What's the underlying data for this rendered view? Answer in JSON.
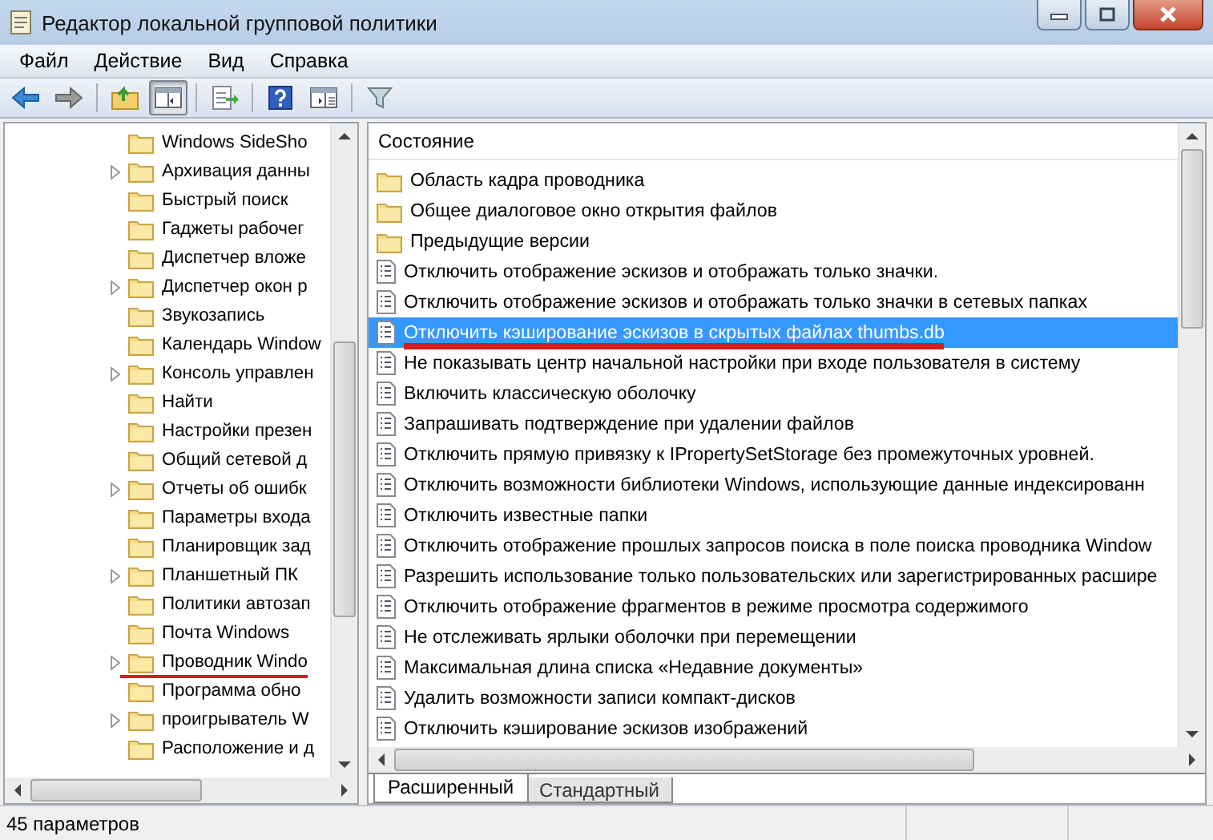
{
  "window": {
    "title": "Редактор локальной групповой политики"
  },
  "menu": [
    "Файл",
    "Действие",
    "Вид",
    "Справка"
  ],
  "toolbar": [
    {
      "kind": "back",
      "pressed": false
    },
    {
      "kind": "forward",
      "pressed": false
    },
    {
      "kind": "sep"
    },
    {
      "kind": "up",
      "pressed": false
    },
    {
      "kind": "tree",
      "pressed": true
    },
    {
      "kind": "sep"
    },
    {
      "kind": "export",
      "pressed": false
    },
    {
      "kind": "sep"
    },
    {
      "kind": "help",
      "pressed": false
    },
    {
      "kind": "pane",
      "pressed": false
    },
    {
      "kind": "sep"
    },
    {
      "kind": "filter",
      "pressed": false
    }
  ],
  "tree": [
    {
      "label": "Windows SideSho",
      "expandable": false,
      "marked": false
    },
    {
      "label": "Архивация данны",
      "expandable": true,
      "marked": false
    },
    {
      "label": "Быстрый поиск",
      "expandable": false,
      "marked": false
    },
    {
      "label": "Гаджеты рабочег",
      "expandable": false,
      "marked": false
    },
    {
      "label": "Диспетчер вложе",
      "expandable": false,
      "marked": false
    },
    {
      "label": "Диспетчер окон р",
      "expandable": true,
      "marked": false
    },
    {
      "label": "Звукозапись",
      "expandable": false,
      "marked": false
    },
    {
      "label": "Календарь Window",
      "expandable": false,
      "marked": false
    },
    {
      "label": "Консоль управлен",
      "expandable": true,
      "marked": false
    },
    {
      "label": "Найти",
      "expandable": false,
      "marked": false
    },
    {
      "label": "Настройки презен",
      "expandable": false,
      "marked": false
    },
    {
      "label": "Общий сетевой д",
      "expandable": false,
      "marked": false
    },
    {
      "label": "Отчеты об ошибк",
      "expandable": true,
      "marked": false
    },
    {
      "label": "Параметры входа",
      "expandable": false,
      "marked": false
    },
    {
      "label": "Планировщик зад",
      "expandable": false,
      "marked": false
    },
    {
      "label": "Планшетный ПК",
      "expandable": true,
      "marked": false
    },
    {
      "label": "Политики автозап",
      "expandable": false,
      "marked": false
    },
    {
      "label": "Почта Windows",
      "expandable": false,
      "marked": false
    },
    {
      "label": "Проводник Windo",
      "expandable": true,
      "marked": true
    },
    {
      "label": "Программа обно",
      "expandable": false,
      "marked": false
    },
    {
      "label": "проигрыватель W",
      "expandable": true,
      "marked": false
    },
    {
      "label": "Расположение и д",
      "expandable": false,
      "marked": false
    }
  ],
  "list": {
    "column": "Состояние",
    "rows": [
      {
        "kind": "folder",
        "label": "Область кадра проводника",
        "selected": false,
        "marked": false
      },
      {
        "kind": "folder",
        "label": "Общее диалоговое окно открытия файлов",
        "selected": false,
        "marked": false
      },
      {
        "kind": "folder",
        "label": "Предыдущие версии",
        "selected": false,
        "marked": false
      },
      {
        "kind": "setting",
        "label": "Отключить отображение эскизов и отображать только значки.",
        "selected": false,
        "marked": false
      },
      {
        "kind": "setting",
        "label": "Отключить отображение эскизов и отображать только значки в сетевых папках",
        "selected": false,
        "marked": false
      },
      {
        "kind": "setting",
        "label": "Отключить кэширование эскизов в скрытых файлах thumbs.db",
        "selected": true,
        "marked": true
      },
      {
        "kind": "setting",
        "label": "Не показывать центр начальной настройки при входе пользователя в систему",
        "selected": false,
        "marked": false
      },
      {
        "kind": "setting",
        "label": "Включить классическую оболочку",
        "selected": false,
        "marked": false
      },
      {
        "kind": "setting",
        "label": "Запрашивать подтверждение при удалении файлов",
        "selected": false,
        "marked": false
      },
      {
        "kind": "setting",
        "label": "Отключить прямую привязку к IPropertySetStorage без промежуточных уровней.",
        "selected": false,
        "marked": false
      },
      {
        "kind": "setting",
        "label": "Отключить возможности библиотеки Windows, использующие данные индексированн",
        "selected": false,
        "marked": false
      },
      {
        "kind": "setting",
        "label": "Отключить известные папки",
        "selected": false,
        "marked": false
      },
      {
        "kind": "setting",
        "label": "Отключить отображение прошлых запросов поиска в поле поиска проводника Window",
        "selected": false,
        "marked": false
      },
      {
        "kind": "setting",
        "label": "Разрешить использование только пользовательских или зарегистрированных расшире",
        "selected": false,
        "marked": false
      },
      {
        "kind": "setting",
        "label": "Отключить отображение фрагментов в режиме просмотра содержимого",
        "selected": false,
        "marked": false
      },
      {
        "kind": "setting",
        "label": "Не отслеживать ярлыки оболочки при перемещении",
        "selected": false,
        "marked": false
      },
      {
        "kind": "setting",
        "label": "Максимальная длина списка «Недавние документы»",
        "selected": false,
        "marked": false
      },
      {
        "kind": "setting",
        "label": "Удалить возможности записи компакт-дисков",
        "selected": false,
        "marked": false
      },
      {
        "kind": "setting",
        "label": "Отключить кэширование эскизов изображений",
        "selected": false,
        "marked": false
      }
    ]
  },
  "tabs": [
    {
      "label": "Расширенный",
      "selected": true
    },
    {
      "label": "Стандартный",
      "selected": false
    }
  ],
  "status_bar": "45 параметров"
}
